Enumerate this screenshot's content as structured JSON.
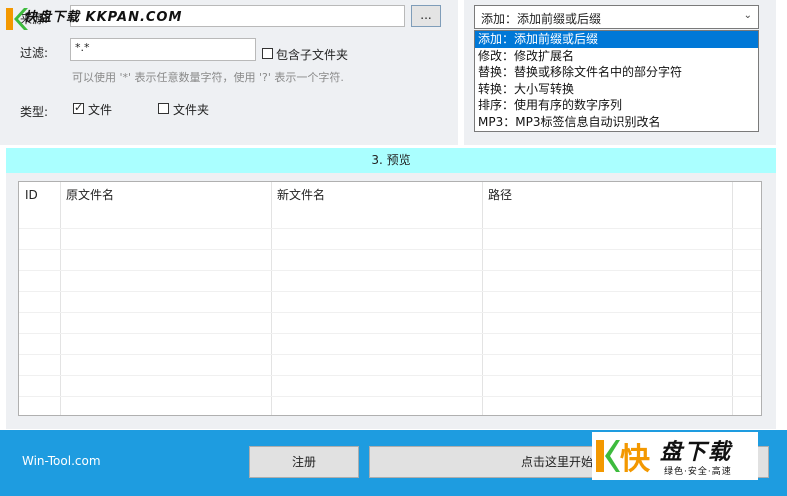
{
  "filter_section": {
    "source_label": "来源:",
    "source_value": "",
    "browse_label": "...",
    "filter_label": "过滤:",
    "filter_value": "*.*",
    "include_subfolders_label": "包含子文件夹",
    "hint": "可以使用 '*' 表示任意数量字符，使用 '?' 表示一个字符.",
    "type_label": "类型:",
    "type_file_label": "文件",
    "type_file_checked": true,
    "type_folder_label": "文件夹",
    "type_folder_checked": false
  },
  "rule_dropdown": {
    "selected": "添加：添加前缀或后缀",
    "options": [
      "添加：添加前缀或后缀",
      "修改：修改扩展名",
      "替换：替换或移除文件名中的部分字符",
      "转换：大小写转换",
      "排序：使用有序的数字序列",
      "MP3：MP3标签信息自动识别改名"
    ],
    "highlighted_index": 0
  },
  "preview": {
    "title": "3. 预览",
    "columns": [
      "ID",
      "原文件名",
      "新文件名",
      "路径"
    ]
  },
  "bottom": {
    "site_link": "Win-Tool.com",
    "register_label": "注册",
    "start_label": "点击这里开始批量"
  },
  "watermarks": {
    "top_text": "快盘下载 KKPAN.COM",
    "bottom_kuai": "快",
    "bottom_main": "盘下载",
    "bottom_sub": "绿色·安全·高速"
  }
}
